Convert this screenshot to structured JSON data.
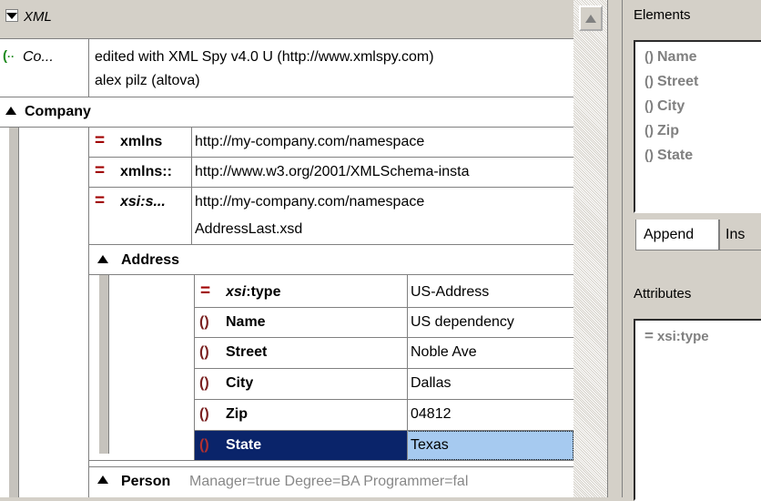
{
  "grid": {
    "header_label": "XML",
    "comment": {
      "label": "Co...",
      "value_line1": "edited with XML Spy v4.0 U (http://www.xmlspy.com)",
      "value_line2": "alex pilz (altova)"
    },
    "company": {
      "label": "Company",
      "attrs": [
        {
          "name": "xmlns",
          "value": "http://my-company.com/namespace"
        },
        {
          "name": "xmlns::",
          "value": "http://www.w3.org/2001/XMLSchema-insta"
        },
        {
          "name": "xsi:s...",
          "value_line1": "http://my-company.com/namespace",
          "value_line2": "AddressLast.xsd"
        }
      ]
    },
    "address": {
      "label": "Address",
      "type_attr": {
        "prefix": "xsi",
        "suffix": ":type",
        "value": "US-Address"
      },
      "rows": [
        {
          "name": "Name",
          "value": "US dependency"
        },
        {
          "name": "Street",
          "value": "Noble Ave"
        },
        {
          "name": "City",
          "value": "Dallas"
        },
        {
          "name": "Zip",
          "value": "04812"
        },
        {
          "name": "State",
          "value": "Texas"
        }
      ]
    },
    "person": {
      "label": "Person",
      "attrs_text": "Manager=true Degree=BA Programmer=fal"
    }
  },
  "elements_panel": {
    "title": "Elements",
    "items": [
      "Name",
      "Street",
      "City",
      "Zip",
      "State"
    ],
    "tabs": [
      "Append",
      "Ins"
    ]
  },
  "attributes_panel": {
    "title": "Attributes",
    "items": [
      "xsi:type"
    ]
  },
  "colors": {
    "selection": "#0a246a",
    "cell_focus": "#a6caf0",
    "eq_icon": "#a00000"
  }
}
